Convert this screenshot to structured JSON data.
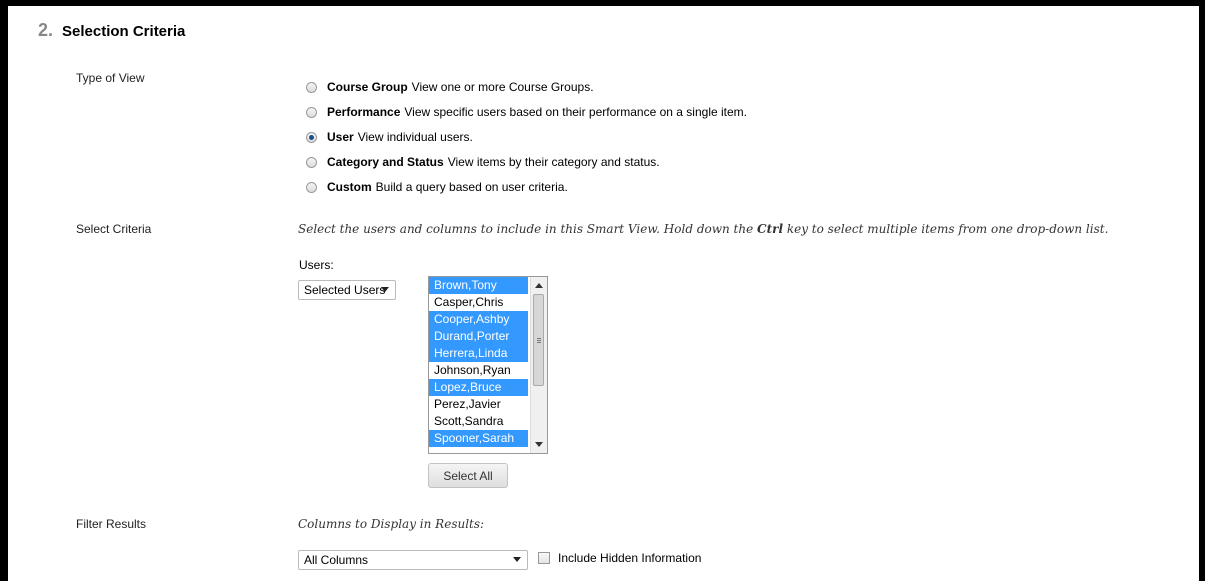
{
  "section": {
    "number": "2.",
    "title": "Selection Criteria"
  },
  "type_of_view": {
    "label": "Type of View",
    "options": [
      {
        "name": "Course Group",
        "desc": "View one or more Course Groups.",
        "checked": false
      },
      {
        "name": "Performance",
        "desc": "View specific users based on their performance on a single item.",
        "checked": false
      },
      {
        "name": "User",
        "desc": "View individual users.",
        "checked": true
      },
      {
        "name": "Category and Status",
        "desc": "View items by their category and status.",
        "checked": false
      },
      {
        "name": "Custom",
        "desc": "Build a query based on user criteria.",
        "checked": false
      }
    ]
  },
  "select_criteria": {
    "label": "Select Criteria",
    "instruction_before": "Select the users and columns to include in this Smart View. Hold down the ",
    "instruction_key": "Ctrl",
    "instruction_after": " key to select multiple items from one drop-down list.",
    "users_label": "Users:",
    "users_dropdown": "Selected Users",
    "users": [
      {
        "name": "Brown,Tony",
        "selected": true
      },
      {
        "name": "Casper,Chris",
        "selected": false
      },
      {
        "name": "Cooper,Ashby",
        "selected": true
      },
      {
        "name": "Durand,Porter",
        "selected": true
      },
      {
        "name": "Herrera,Linda",
        "selected": true
      },
      {
        "name": "Johnson,Ryan",
        "selected": false
      },
      {
        "name": "Lopez,Bruce",
        "selected": true
      },
      {
        "name": "Perez,Javier",
        "selected": false
      },
      {
        "name": "Scott,Sandra",
        "selected": false
      },
      {
        "name": "Spooner,Sarah",
        "selected": true
      }
    ],
    "select_all_label": "Select All"
  },
  "filter_results": {
    "label": "Filter Results",
    "columns_label": "Columns to Display in Results:",
    "columns_dropdown": "All Columns",
    "include_hidden_label": "Include Hidden Information",
    "include_hidden_checked": false
  },
  "colors": {
    "selection": "#3399ff",
    "radio_dot": "#1c4f87"
  }
}
